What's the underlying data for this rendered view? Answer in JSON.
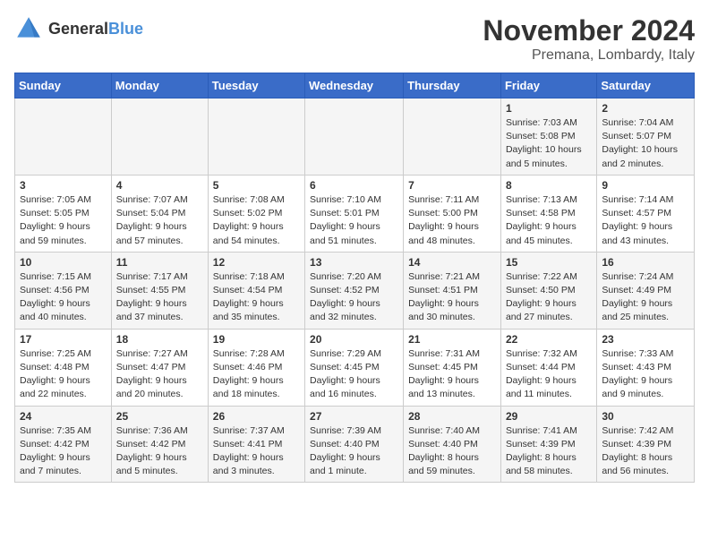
{
  "logo": {
    "general": "General",
    "blue": "Blue"
  },
  "title": "November 2024",
  "location": "Premana, Lombardy, Italy",
  "days_header": [
    "Sunday",
    "Monday",
    "Tuesday",
    "Wednesday",
    "Thursday",
    "Friday",
    "Saturday"
  ],
  "weeks": [
    [
      {
        "day": "",
        "info": ""
      },
      {
        "day": "",
        "info": ""
      },
      {
        "day": "",
        "info": ""
      },
      {
        "day": "",
        "info": ""
      },
      {
        "day": "",
        "info": ""
      },
      {
        "day": "1",
        "info": "Sunrise: 7:03 AM\nSunset: 5:08 PM\nDaylight: 10 hours\nand 5 minutes."
      },
      {
        "day": "2",
        "info": "Sunrise: 7:04 AM\nSunset: 5:07 PM\nDaylight: 10 hours\nand 2 minutes."
      }
    ],
    [
      {
        "day": "3",
        "info": "Sunrise: 7:05 AM\nSunset: 5:05 PM\nDaylight: 9 hours\nand 59 minutes."
      },
      {
        "day": "4",
        "info": "Sunrise: 7:07 AM\nSunset: 5:04 PM\nDaylight: 9 hours\nand 57 minutes."
      },
      {
        "day": "5",
        "info": "Sunrise: 7:08 AM\nSunset: 5:02 PM\nDaylight: 9 hours\nand 54 minutes."
      },
      {
        "day": "6",
        "info": "Sunrise: 7:10 AM\nSunset: 5:01 PM\nDaylight: 9 hours\nand 51 minutes."
      },
      {
        "day": "7",
        "info": "Sunrise: 7:11 AM\nSunset: 5:00 PM\nDaylight: 9 hours\nand 48 minutes."
      },
      {
        "day": "8",
        "info": "Sunrise: 7:13 AM\nSunset: 4:58 PM\nDaylight: 9 hours\nand 45 minutes."
      },
      {
        "day": "9",
        "info": "Sunrise: 7:14 AM\nSunset: 4:57 PM\nDaylight: 9 hours\nand 43 minutes."
      }
    ],
    [
      {
        "day": "10",
        "info": "Sunrise: 7:15 AM\nSunset: 4:56 PM\nDaylight: 9 hours\nand 40 minutes."
      },
      {
        "day": "11",
        "info": "Sunrise: 7:17 AM\nSunset: 4:55 PM\nDaylight: 9 hours\nand 37 minutes."
      },
      {
        "day": "12",
        "info": "Sunrise: 7:18 AM\nSunset: 4:54 PM\nDaylight: 9 hours\nand 35 minutes."
      },
      {
        "day": "13",
        "info": "Sunrise: 7:20 AM\nSunset: 4:52 PM\nDaylight: 9 hours\nand 32 minutes."
      },
      {
        "day": "14",
        "info": "Sunrise: 7:21 AM\nSunset: 4:51 PM\nDaylight: 9 hours\nand 30 minutes."
      },
      {
        "day": "15",
        "info": "Sunrise: 7:22 AM\nSunset: 4:50 PM\nDaylight: 9 hours\nand 27 minutes."
      },
      {
        "day": "16",
        "info": "Sunrise: 7:24 AM\nSunset: 4:49 PM\nDaylight: 9 hours\nand 25 minutes."
      }
    ],
    [
      {
        "day": "17",
        "info": "Sunrise: 7:25 AM\nSunset: 4:48 PM\nDaylight: 9 hours\nand 22 minutes."
      },
      {
        "day": "18",
        "info": "Sunrise: 7:27 AM\nSunset: 4:47 PM\nDaylight: 9 hours\nand 20 minutes."
      },
      {
        "day": "19",
        "info": "Sunrise: 7:28 AM\nSunset: 4:46 PM\nDaylight: 9 hours\nand 18 minutes."
      },
      {
        "day": "20",
        "info": "Sunrise: 7:29 AM\nSunset: 4:45 PM\nDaylight: 9 hours\nand 16 minutes."
      },
      {
        "day": "21",
        "info": "Sunrise: 7:31 AM\nSunset: 4:45 PM\nDaylight: 9 hours\nand 13 minutes."
      },
      {
        "day": "22",
        "info": "Sunrise: 7:32 AM\nSunset: 4:44 PM\nDaylight: 9 hours\nand 11 minutes."
      },
      {
        "day": "23",
        "info": "Sunrise: 7:33 AM\nSunset: 4:43 PM\nDaylight: 9 hours\nand 9 minutes."
      }
    ],
    [
      {
        "day": "24",
        "info": "Sunrise: 7:35 AM\nSunset: 4:42 PM\nDaylight: 9 hours\nand 7 minutes."
      },
      {
        "day": "25",
        "info": "Sunrise: 7:36 AM\nSunset: 4:42 PM\nDaylight: 9 hours\nand 5 minutes."
      },
      {
        "day": "26",
        "info": "Sunrise: 7:37 AM\nSunset: 4:41 PM\nDaylight: 9 hours\nand 3 minutes."
      },
      {
        "day": "27",
        "info": "Sunrise: 7:39 AM\nSunset: 4:40 PM\nDaylight: 9 hours\nand 1 minute."
      },
      {
        "day": "28",
        "info": "Sunrise: 7:40 AM\nSunset: 4:40 PM\nDaylight: 8 hours\nand 59 minutes."
      },
      {
        "day": "29",
        "info": "Sunrise: 7:41 AM\nSunset: 4:39 PM\nDaylight: 8 hours\nand 58 minutes."
      },
      {
        "day": "30",
        "info": "Sunrise: 7:42 AM\nSunset: 4:39 PM\nDaylight: 8 hours\nand 56 minutes."
      }
    ]
  ]
}
